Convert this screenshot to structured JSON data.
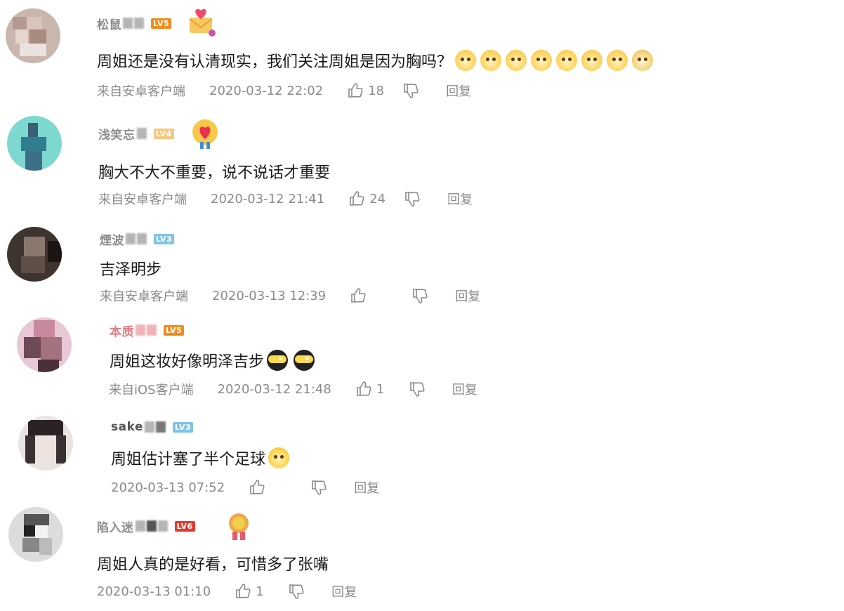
{
  "comments": [
    {
      "username": "松鼠",
      "level": "LV5",
      "level_color": "#f08c1e",
      "medal_icon": "love-letter-icon",
      "text": "周姐还是没有认清现实，我们关注周姐是因为胸吗？",
      "emojis": [
        "cat-face-icon",
        "cat-face-icon",
        "cat-face-icon",
        "cat-face-icon",
        "cat-face-icon",
        "cat-face-icon",
        "cat-face-icon",
        "doge-face-icon"
      ],
      "source": "来自安卓客户端",
      "time": "2020-03-12 22:02",
      "likes": "18",
      "reply": "回复"
    },
    {
      "username": "浅笑忘",
      "level": "LV4",
      "level_color": "#f5b04a",
      "medal_icon": "heart-medal-icon",
      "text": "胸大不大不重要，说不说话才重要",
      "emojis": [],
      "source": "来自安卓客户端",
      "time": "2020-03-12 21:41",
      "likes": "24",
      "reply": "回复"
    },
    {
      "username": "煙波",
      "level": "LV3",
      "level_color": "#7ec4e6",
      "medal_icon": "",
      "text": "吉泽明步",
      "emojis": [],
      "source": "来自安卓客户端",
      "time": "2020-03-13 12:39",
      "likes": "",
      "reply": "回复"
    },
    {
      "username": "本质",
      "level": "LV5",
      "level_color": "#f08c1e",
      "medal_icon": "",
      "text": "周姐这妆好像明泽吉步",
      "emojis": [
        "ninja-face-icon",
        "ninja-face-icon"
      ],
      "source": "来自iOS客户端",
      "time": "2020-03-12 21:48",
      "likes": "1",
      "reply": "回复"
    },
    {
      "username": "sake",
      "level": "LV3",
      "level_color": "#7ec4e6",
      "medal_icon": "",
      "text": "周姐估计塞了半个足球",
      "emojis": [
        "laughing-face-icon"
      ],
      "source": "",
      "time": "2020-03-13 07:52",
      "likes": "",
      "reply": "回复"
    },
    {
      "username": "陷入迷",
      "level": "LV6",
      "level_color": "#e23a2e",
      "medal_icon": "ribbon-medal-icon",
      "text": "周姐人真的是好看，可惜多了张嘴",
      "emojis": [],
      "source": "",
      "time": "2020-03-13 01:10",
      "likes": "1",
      "reply": "回复"
    }
  ]
}
